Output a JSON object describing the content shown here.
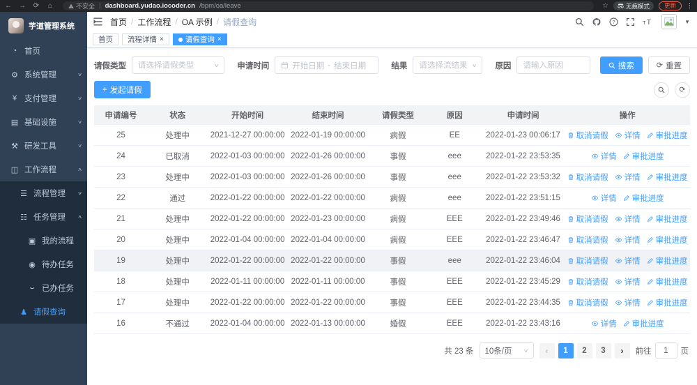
{
  "browser": {
    "security_label": "不安全",
    "url_host": "dashboard.yudao.iocoder.cn",
    "url_path": "/bpm/oa/leave",
    "incognito_label": "无痕模式",
    "update_label": "更新"
  },
  "sidebar": {
    "app_title": "芋道管理系统",
    "items": [
      {
        "key": "home",
        "label": "首页",
        "icon": "dashboard-icon",
        "level": 1,
        "sub": false,
        "arrow": null,
        "active": false
      },
      {
        "key": "system",
        "label": "系统管理",
        "icon": "gear-icon",
        "level": 1,
        "sub": false,
        "arrow": "down",
        "active": false
      },
      {
        "key": "payment",
        "label": "支付管理",
        "icon": "yen-icon",
        "level": 1,
        "sub": false,
        "arrow": "down",
        "active": false
      },
      {
        "key": "infra",
        "label": "基础设施",
        "icon": "monitor-icon",
        "level": 1,
        "sub": false,
        "arrow": "down",
        "active": false
      },
      {
        "key": "devtools",
        "label": "研发工具",
        "icon": "tools-icon",
        "level": 1,
        "sub": false,
        "arrow": "down",
        "active": false
      },
      {
        "key": "workflow",
        "label": "工作流程",
        "icon": "briefcase-icon",
        "level": 1,
        "sub": false,
        "arrow": "up",
        "active": false
      },
      {
        "key": "process-mgmt",
        "label": "流程管理",
        "icon": "list-icon",
        "level": 2,
        "sub": true,
        "arrow": "down",
        "active": false
      },
      {
        "key": "task-mgmt",
        "label": "任务管理",
        "icon": "tasks-icon",
        "level": 2,
        "sub": true,
        "arrow": "up",
        "active": false
      },
      {
        "key": "my-process",
        "label": "我的流程",
        "icon": "my-process-icon",
        "level": 3,
        "sub": true,
        "arrow": null,
        "active": false
      },
      {
        "key": "todo-tasks",
        "label": "待办任务",
        "icon": "eye-icon",
        "level": 3,
        "sub": true,
        "arrow": null,
        "active": false
      },
      {
        "key": "done-tasks",
        "label": "已办任务",
        "icon": "done-icon",
        "level": 3,
        "sub": true,
        "arrow": null,
        "active": false
      },
      {
        "key": "leave-query",
        "label": "请假查询",
        "icon": "person-icon",
        "level": 2,
        "sub": true,
        "arrow": null,
        "active": true
      }
    ]
  },
  "header": {
    "breadcrumb": [
      "首页",
      "工作流程",
      "OA 示例",
      "请假查询"
    ]
  },
  "tabs": [
    {
      "key": "home",
      "label": "首页",
      "closable": false,
      "active": false
    },
    {
      "key": "process-detail",
      "label": "流程详情",
      "closable": true,
      "active": false
    },
    {
      "key": "leave-query",
      "label": "请假查询",
      "closable": true,
      "active": true
    }
  ],
  "filters": {
    "leave_type_label": "请假类型",
    "leave_type_placeholder": "请选择请假类型",
    "apply_time_label": "申请时间",
    "start_placeholder": "开始日期",
    "range_separator": "-",
    "end_placeholder": "结束日期",
    "result_label": "结果",
    "result_placeholder": "请选择流结果",
    "reason_label": "原因",
    "reason_placeholder": "请输入原因",
    "search_label": "搜索",
    "reset_label": "重置"
  },
  "toolbar": {
    "create_label": "发起请假"
  },
  "table": {
    "headers": [
      "申请编号",
      "状态",
      "开始时间",
      "结束时间",
      "请假类型",
      "原因",
      "申请时间",
      "操作"
    ],
    "action_labels": {
      "cancel": "取消请假",
      "detail": "详情",
      "progress": "审批进度"
    },
    "rows": [
      {
        "id": "25",
        "status": "处理中",
        "start": "2021-12-27 00:00:00",
        "end": "2022-01-19 00:00:00",
        "type": "病假",
        "reason": "EE",
        "applied": "2022-01-23 00:06:17",
        "cancellable": true,
        "highlight": false
      },
      {
        "id": "24",
        "status": "已取消",
        "start": "2022-01-03 00:00:00",
        "end": "2022-01-26 00:00:00",
        "type": "事假",
        "reason": "eee",
        "applied": "2022-01-22 23:53:35",
        "cancellable": false,
        "highlight": false
      },
      {
        "id": "23",
        "status": "处理中",
        "start": "2022-01-03 00:00:00",
        "end": "2022-01-26 00:00:00",
        "type": "事假",
        "reason": "eee",
        "applied": "2022-01-22 23:53:32",
        "cancellable": true,
        "highlight": false
      },
      {
        "id": "22",
        "status": "通过",
        "start": "2022-01-22 00:00:00",
        "end": "2022-01-22 00:00:00",
        "type": "病假",
        "reason": "eee",
        "applied": "2022-01-22 23:51:15",
        "cancellable": false,
        "highlight": false
      },
      {
        "id": "21",
        "status": "处理中",
        "start": "2022-01-22 00:00:00",
        "end": "2022-01-23 00:00:00",
        "type": "病假",
        "reason": "EEE",
        "applied": "2022-01-22 23:49:46",
        "cancellable": true,
        "highlight": false
      },
      {
        "id": "20",
        "status": "处理中",
        "start": "2022-01-04 00:00:00",
        "end": "2022-01-04 00:00:00",
        "type": "病假",
        "reason": "EEE",
        "applied": "2022-01-22 23:46:47",
        "cancellable": true,
        "highlight": false
      },
      {
        "id": "19",
        "status": "处理中",
        "start": "2022-01-22 00:00:00",
        "end": "2022-01-22 00:00:00",
        "type": "事假",
        "reason": "eee",
        "applied": "2022-01-22 23:46:04",
        "cancellable": true,
        "highlight": true
      },
      {
        "id": "18",
        "status": "处理中",
        "start": "2022-01-11 00:00:00",
        "end": "2022-01-11 00:00:00",
        "type": "事假",
        "reason": "EEE",
        "applied": "2022-01-22 23:45:29",
        "cancellable": true,
        "highlight": false
      },
      {
        "id": "17",
        "status": "处理中",
        "start": "2022-01-22 00:00:00",
        "end": "2022-01-22 00:00:00",
        "type": "事假",
        "reason": "EEE",
        "applied": "2022-01-22 23:44:35",
        "cancellable": true,
        "highlight": false
      },
      {
        "id": "16",
        "status": "不通过",
        "start": "2022-01-04 00:00:00",
        "end": "2022-01-13 00:00:00",
        "type": "婚假",
        "reason": "EEE",
        "applied": "2022-01-22 23:43:16",
        "cancellable": false,
        "highlight": false
      }
    ]
  },
  "pagination": {
    "total_label": "共 23 条",
    "page_size_label": "10条/页",
    "pages": [
      "1",
      "2",
      "3"
    ],
    "active_page": "1",
    "prev_symbol": "‹",
    "next_symbol": "›",
    "goto_label": "前往",
    "goto_value": "1",
    "page_unit_label": "页"
  },
  "colors": {
    "accent": "#409eff",
    "sidebar_bg": "#304156",
    "submenu_bg": "#1f2d3d",
    "update_accent": "#f0654a"
  }
}
